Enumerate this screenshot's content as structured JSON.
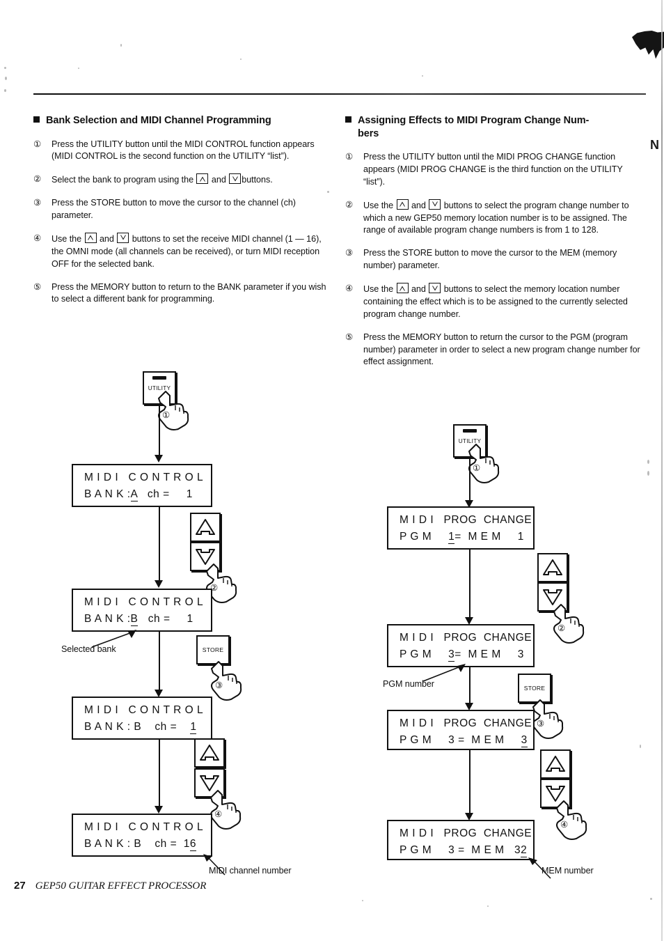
{
  "page": {
    "number": "27",
    "footer_title": "GEP50 GUITAR EFFECT PROCESSOR",
    "margin_bleed_char": "N"
  },
  "sections": [
    {
      "id": "bank-selection",
      "heading": "Bank Selection and MIDI Channel Programming",
      "heading_cont": "",
      "steps": [
        {
          "num": "①",
          "parts": [
            {
              "t": "text",
              "v": "Press the UTILITY button until the MIDI CONTROL function appears  (MIDI CONTROL is the second function on the UTILITY “list”)."
            }
          ]
        },
        {
          "num": "②",
          "parts": [
            {
              "t": "text",
              "v": "Select the bank to program using the "
            },
            {
              "t": "icon",
              "v": "triangle-up-icon"
            },
            {
              "t": "text",
              "v": " and "
            },
            {
              "t": "icon",
              "v": "triangle-down-icon"
            },
            {
              "t": "text",
              "v": "buttons."
            }
          ]
        },
        {
          "num": "③",
          "parts": [
            {
              "t": "text",
              "v": "Press the STORE button to move the cursor to the channel (ch)  parameter."
            }
          ]
        },
        {
          "num": "④",
          "parts": [
            {
              "t": "text",
              "v": "Use the "
            },
            {
              "t": "icon",
              "v": "triangle-up-icon"
            },
            {
              "t": "text",
              "v": " and "
            },
            {
              "t": "icon",
              "v": "triangle-down-icon"
            },
            {
              "t": "text",
              "v": " buttons to set the receive MIDI channel (1 —  16), the OMNI mode (all channels can be received), or turn MIDI  reception OFF for the selected bank."
            }
          ]
        },
        {
          "num": "⑤",
          "parts": [
            {
              "t": "text",
              "v": "Press the MEMORY button to return to the BANK parameter if  you wish to select a different bank for programming."
            }
          ]
        }
      ]
    },
    {
      "id": "assigning-effects",
      "heading": "Assigning Effects to MIDI Program Change Num-",
      "heading_cont": "bers",
      "steps": [
        {
          "num": "①",
          "parts": [
            {
              "t": "text",
              "v": "Press the UTILITY button until the MIDI PROG CHANGE function appears (MIDI PROG CHANGE is the third function on the UTILITY  “list”)."
            }
          ]
        },
        {
          "num": "②",
          "parts": [
            {
              "t": "text",
              "v": "Use the "
            },
            {
              "t": "icon",
              "v": "triangle-up-icon"
            },
            {
              "t": "text",
              "v": " and "
            },
            {
              "t": "icon",
              "v": "triangle-down-icon"
            },
            {
              "t": "text",
              "v": " buttons to select the program change number to  which a new GEP50 memory location number is to be assigned. The  range of available program change numbers is from 1 to 128."
            }
          ]
        },
        {
          "num": "③",
          "parts": [
            {
              "t": "text",
              "v": "Press the STORE button to move the cursor to the MEM (memory  number) parameter."
            }
          ]
        },
        {
          "num": "④",
          "parts": [
            {
              "t": "text",
              "v": "Use the "
            },
            {
              "t": "icon",
              "v": "triangle-up-icon"
            },
            {
              "t": "text",
              "v": " and "
            },
            {
              "t": "icon",
              "v": "triangle-down-icon"
            },
            {
              "t": "text",
              "v": " buttons to select the memory location number  containing the effect which is to be assigned to the currently  selected program change number."
            }
          ]
        },
        {
          "num": "⑤",
          "parts": [
            {
              "t": "text",
              "v": "Press the MEMORY button to return the cursor to the PGM (program number) parameter in order to select a new program  change number for effect assignment."
            }
          ]
        }
      ]
    }
  ],
  "diagrams": {
    "left": {
      "utility_button": {
        "label": "UTILITY"
      },
      "store_button": {
        "label": "STORE"
      },
      "hand_steps": [
        "①",
        "②",
        "③",
        "④"
      ],
      "annotations": [
        {
          "id": "selected-bank",
          "text": "Selected bank"
        },
        {
          "id": "midi-channel-number",
          "text": "MIDI channel number"
        }
      ],
      "screens": [
        {
          "id": "lcd-1",
          "line1": "M I D I   C O N T R O L",
          "line2_pre": "B A N K :",
          "line2_cursor": "A",
          "line2_post": "   ch =     1",
          "underline": "bank"
        },
        {
          "id": "lcd-2",
          "line1": "M I D I   C O N T R O L",
          "line2_pre": "B A N K :",
          "line2_cursor": "B",
          "line2_post": "   ch =     1",
          "underline": "bank"
        },
        {
          "id": "lcd-3",
          "line1": "M I D I   C O N T R O L",
          "line2_pre": "B A N K : B    ch =    ",
          "line2_cursor": "1",
          "line2_post": "",
          "underline": "ch"
        },
        {
          "id": "lcd-4",
          "line1": "M I D I   C O N T R O L",
          "line2_pre": "B A N K : B    ch =  1",
          "line2_cursor": "6",
          "line2_post": "",
          "underline": "ch"
        }
      ]
    },
    "right": {
      "utility_button": {
        "label": "UTILITY"
      },
      "store_button": {
        "label": "STORE"
      },
      "hand_steps": [
        "①",
        "②",
        "③",
        "④"
      ],
      "annotations": [
        {
          "id": "pgm-number",
          "text": "PGM number"
        },
        {
          "id": "mem-number",
          "text": "MEM number"
        }
      ],
      "screens": [
        {
          "id": "lcd-r1",
          "line1": "M I D I   PROG  CHANGE",
          "line2_pre": "P G M     ",
          "line2_cursor": "1",
          "line2_post": "=  M E M     1",
          "underline": "pgm"
        },
        {
          "id": "lcd-r2",
          "line1": "M I D I   PROG  CHANGE",
          "line2_pre": "P G M     ",
          "line2_cursor": "3",
          "line2_post": "=  M E M     3",
          "underline": "pgm"
        },
        {
          "id": "lcd-r3",
          "line1": "M I D I   PROG  CHANGE",
          "line2_pre": "P G M     3 =  M E M     ",
          "line2_cursor": "3",
          "line2_post": "",
          "underline": "mem"
        },
        {
          "id": "lcd-r4",
          "line1": "M I D I   PROG  CHANGE",
          "line2_pre": "P G M     3 =  M E M   3",
          "line2_cursor": "2",
          "line2_post": "",
          "underline": "mem"
        }
      ]
    }
  }
}
